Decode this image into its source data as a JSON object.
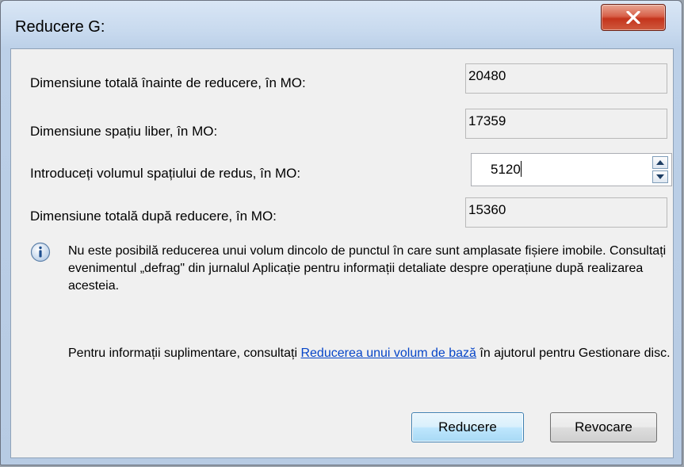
{
  "dialog": {
    "title": "Reducere G:",
    "close_glyph": "X"
  },
  "fields": [
    {
      "label": "Dimensiune totală înainte de reducere, în MO:",
      "value": "20480"
    },
    {
      "label": "Dimensiune spațiu liber, în MO:",
      "value": "17359"
    },
    {
      "label": "Introduceți volumul spațiului de redus, în MO:",
      "value": "5120"
    },
    {
      "label": "Dimensiune totală după reducere, în MO:",
      "value": "15360"
    }
  ],
  "info": {
    "icon": "info-icon",
    "text": "Nu este posibilă reducerea unui volum dincolo de punctul în care sunt amplasate fișiere imobile. Consultați evenimentul „defrag\" din jurnalul Aplicație pentru informații detaliate despre operațiune după realizarea acesteia."
  },
  "help": {
    "prefix": "Pentru informații suplimentare, consultați ",
    "link": "Reducerea unui volum de bază",
    "suffix": " în ajutorul pentru Gestionare disc."
  },
  "buttons": {
    "ok": "Reducere",
    "cancel": "Revocare"
  },
  "colors": {
    "link": "#0645c8",
    "close_button": "#c4341c",
    "dialog_background": "#f0f0f0"
  }
}
